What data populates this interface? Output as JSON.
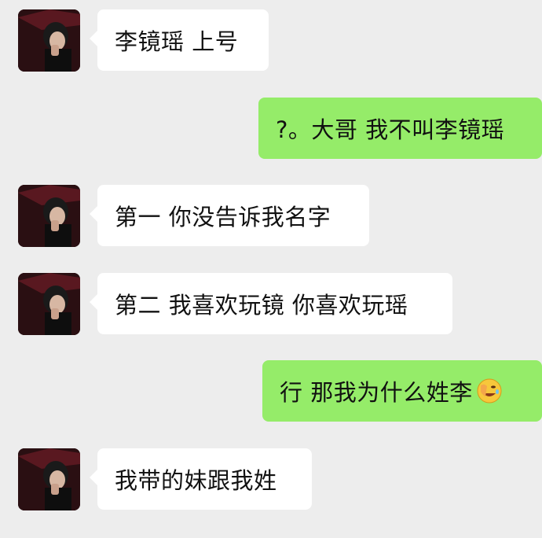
{
  "messages": [
    {
      "side": "left",
      "text": "李镜瑶 上号",
      "avatar_icon": "user-avatar-icon"
    },
    {
      "side": "right",
      "text": "?。大哥 我不叫李镜瑶"
    },
    {
      "side": "left",
      "text": "第一 你没告诉我名字",
      "avatar_icon": "user-avatar-icon"
    },
    {
      "side": "left",
      "text": "第二 我喜欢玩镜 你喜欢玩瑶",
      "avatar_icon": "user-avatar-icon"
    },
    {
      "side": "right",
      "text": "行  那我为什么姓李",
      "trailing_emoji": "facepalm-laugh-emoji-icon"
    },
    {
      "side": "left",
      "text": "我带的妹跟我姓",
      "avatar_icon": "user-avatar-icon"
    }
  ],
  "colors": {
    "background": "#ededed",
    "incoming_bubble": "#ffffff",
    "outgoing_bubble": "#95ec69"
  }
}
